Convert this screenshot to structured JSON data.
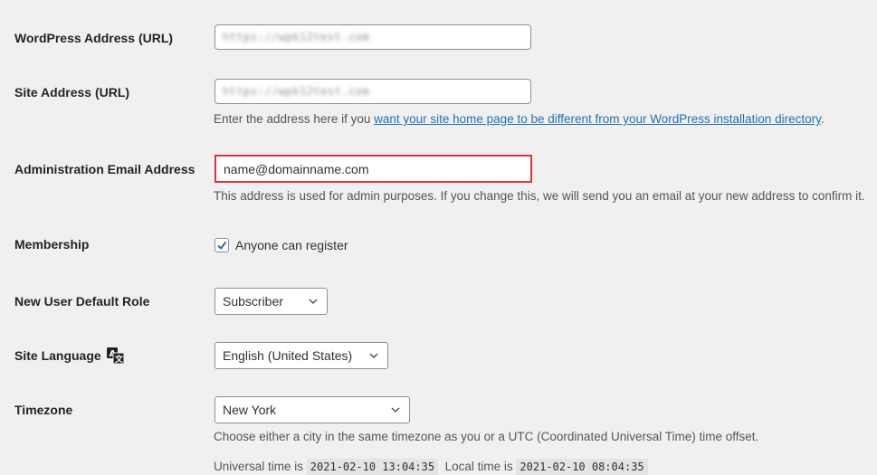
{
  "fields": {
    "wp_address": {
      "label": "WordPress Address (URL)",
      "value": "https://wpk12test.com"
    },
    "site_address": {
      "label": "Site Address (URL)",
      "value": "https://wpk12test.com",
      "description_prefix": "Enter the address here if you ",
      "description_link": "want your site home page to be different from your WordPress installation directory",
      "description_suffix": "."
    },
    "admin_email": {
      "label": "Administration Email Address",
      "value": "name@domainname.com",
      "description": "This address is used for admin purposes. If you change this, we will send you an email at your new address to confirm it."
    },
    "membership": {
      "label": "Membership",
      "checkbox_label": "Anyone can register",
      "checked": true
    },
    "default_role": {
      "label": "New User Default Role",
      "selected": "Subscriber"
    },
    "site_language": {
      "label": "Site Language",
      "icon": "translate-icon",
      "selected": "English (United States)"
    },
    "timezone": {
      "label": "Timezone",
      "selected": "New York",
      "description": "Choose either a city in the same timezone as you or a UTC (Coordinated Universal Time) time offset.",
      "universal_label": "Universal time is",
      "universal_time": "2021-02-10 13:04:35",
      "local_label": "Local time is",
      "local_time": "2021-02-10 08:04:35"
    }
  },
  "colors": {
    "link": "#2271b1",
    "invalid_border": "#d63638",
    "checkbox": "#2271b1"
  }
}
